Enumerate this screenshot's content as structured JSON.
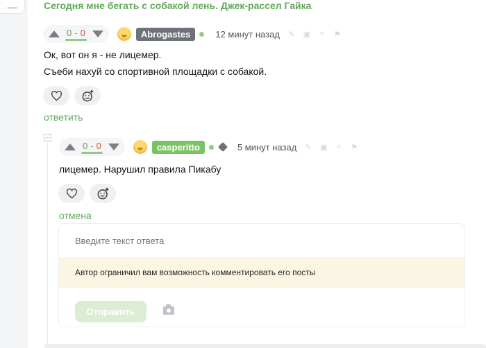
{
  "story": {
    "title": "Сегодня мне бегать с собакой лень. Джек-рассел Гайка"
  },
  "comment1": {
    "votes": {
      "plus": "0",
      "sep": "-",
      "minus": "0"
    },
    "author": "Abrogastes",
    "time": "12 минут назад",
    "lines": [
      "Ок, вот он я - не лицемер.",
      "Съеби нахуй со спортивной площадки с собакой."
    ],
    "reply_label": "ответить"
  },
  "comment2": {
    "votes": {
      "plus": "0",
      "sep": "-",
      "minus": "0"
    },
    "author": "casperitto",
    "time": "5 минут назад",
    "text": "лицемер. Нарушил правила Пикабу",
    "cancel_label": "отмена"
  },
  "reply_form": {
    "placeholder": "Введите текст ответа",
    "notice": "Автор ограничил вам возможность комментировать его посты",
    "send_label": "Отправить"
  },
  "colors": {
    "accent_green": "#62a85a",
    "vote_plus": "#5ca64b",
    "vote_minus": "#d9533d",
    "nick_dark": "#6c7278",
    "nick_green": "#7ac365",
    "notice_bg": "#fbf6e3"
  }
}
